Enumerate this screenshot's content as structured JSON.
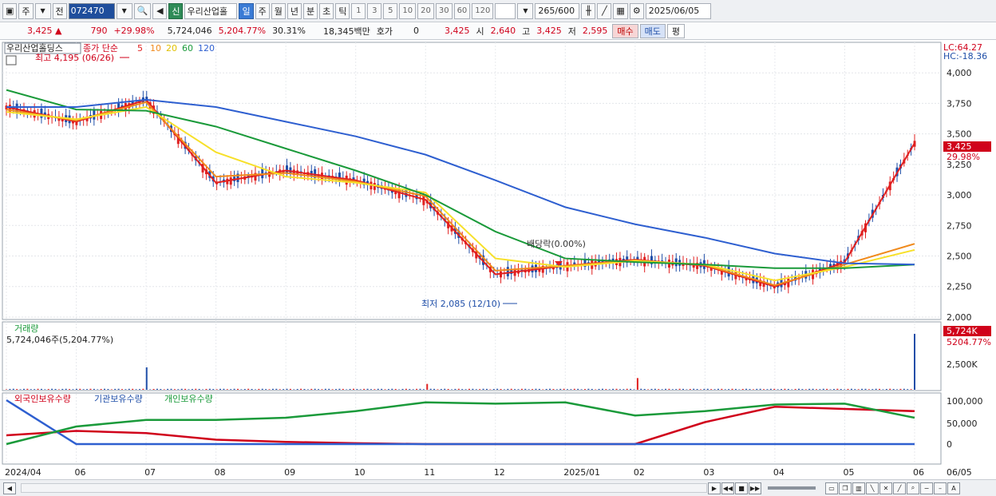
{
  "toolbar": {
    "period_label": "주",
    "prev_label": "전",
    "code": "072470",
    "badge": "신",
    "name": "우리산업홀",
    "day_tab": "일",
    "week_tab": "주",
    "month_tab": "월",
    "year_tab": "년",
    "minute_tab": "분",
    "second_tab": "초",
    "tick_tab": "틱",
    "intervals": [
      "1",
      "3",
      "5",
      "10",
      "20",
      "30",
      "60",
      "120"
    ],
    "count": "265",
    "count_total": "/600",
    "date": "2025/06/05"
  },
  "quote": {
    "price": "3,425",
    "change": "790",
    "change_pct": "+29.98%",
    "volume": "5,724,046",
    "volume_pct": "5,204.77%",
    "turnover": "30.31%",
    "amount": "18,345백만",
    "hoga_label": "호가",
    "hoga_value": "0",
    "hoga_price": "3,425",
    "open_label": "시",
    "open": "2,640",
    "high_label": "고",
    "high": "3,425",
    "low_label": "저",
    "low": "2,595",
    "buy_label": "매수",
    "sell_label": "매도",
    "eval_label": "평"
  },
  "price_panel": {
    "stock_name": "우리산업홀딩스",
    "ma_label": "종가 단순",
    "ma_periods": [
      "5",
      "10",
      "20",
      "60",
      "120"
    ],
    "ma_colors": [
      "#e02020",
      "#f08a1c",
      "#f7e02a",
      "#1a9a3a",
      "#2e5fd0"
    ],
    "lc": "LC:64.27",
    "hc": "HC:-18.36",
    "y_ticks": [
      "4,000",
      "3,750",
      "3,500",
      "3,250",
      "3,000",
      "2,750",
      "2,500",
      "2,250",
      "2,000"
    ],
    "y_values": [
      4000,
      3750,
      3500,
      3250,
      3000,
      2750,
      2500,
      2250,
      2000
    ],
    "current_price": "3,425",
    "current_pct": "29.98%",
    "high_annot": "최고 4,195 (06/26)",
    "low_annot": "최저 2,085 (12/10)",
    "dividend_annot": "배당락(0.00%)"
  },
  "volume_panel": {
    "title": "거래량",
    "value": "5,724,046주(5,204.77%)",
    "current": "5,724K",
    "current_pct": "5204.77%",
    "tick": "2,500K"
  },
  "holding_panel": {
    "foreign_label": "외국인보유수량",
    "inst_label": "기관보유수량",
    "indiv_label": "개인보유수량",
    "y_ticks": [
      "100,000",
      "50,000",
      "0"
    ]
  },
  "x_axis": {
    "labels": [
      "2024/04",
      "06",
      "07",
      "08",
      "09",
      "10",
      "11",
      "12",
      "2025/01",
      "02",
      "03",
      "04",
      "05",
      "06"
    ],
    "end_label": "06/05"
  },
  "chart_data": {
    "type": "line",
    "x_labels": [
      "2024/04",
      "06",
      "07",
      "08",
      "09",
      "10",
      "11",
      "12",
      "2025/01",
      "02",
      "03",
      "04",
      "05",
      "06"
    ],
    "series": [
      {
        "name": "5",
        "values": [
          3720,
          3600,
          3780,
          3100,
          3200,
          3120,
          2960,
          2350,
          2420,
          2470,
          2420,
          2250,
          2450,
          3425
        ]
      },
      {
        "name": "10",
        "values": [
          3700,
          3610,
          3760,
          3150,
          3180,
          3110,
          2990,
          2380,
          2420,
          2465,
          2425,
          2260,
          2430,
          2600
        ]
      },
      {
        "name": "20",
        "values": [
          3680,
          3620,
          3720,
          3350,
          3150,
          3100,
          3020,
          2480,
          2410,
          2460,
          2430,
          2300,
          2410,
          2550
        ]
      },
      {
        "name": "60",
        "values": [
          3860,
          3700,
          3690,
          3560,
          3380,
          3200,
          3000,
          2700,
          2480,
          2450,
          2430,
          2400,
          2400,
          2430
        ]
      },
      {
        "name": "120",
        "values": [
          3720,
          3720,
          3780,
          3720,
          3600,
          3480,
          3330,
          3120,
          2900,
          2760,
          2650,
          2520,
          2440,
          2430
        ]
      }
    ],
    "high": {
      "value": 4195,
      "date": "06/26"
    },
    "low": {
      "value": 2085,
      "date": "12/10"
    },
    "last": 3425,
    "ylim": [
      1980,
      4250
    ],
    "volume": {
      "last": 5724046,
      "peaks": [
        2300000,
        600000,
        1200000,
        5724046
      ]
    },
    "holdings": {
      "foreign": [
        20000,
        30000,
        25000,
        10000,
        5000,
        2000,
        0,
        0,
        0,
        0,
        50000,
        85000,
        80000,
        75000
      ],
      "institution": [
        100000,
        0,
        0,
        0,
        0,
        0,
        0,
        0,
        0,
        0,
        0,
        0,
        0,
        0
      ],
      "individual": [
        0,
        40000,
        55000,
        55000,
        60000,
        75000,
        95000,
        92000,
        95000,
        65000,
        75000,
        90000,
        92000,
        60000
      ]
    }
  }
}
